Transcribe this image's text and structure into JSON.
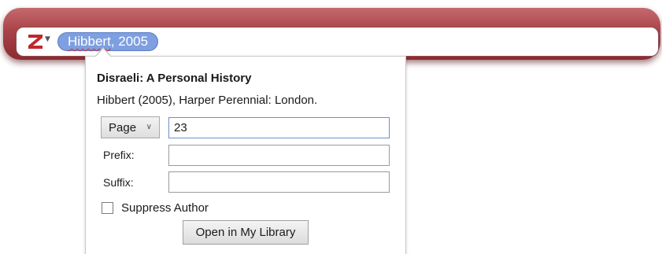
{
  "quick_format_bar": {
    "logo_icon": "zotero-z-logo-icon",
    "logo_color": "#c0272d",
    "menu_icon": "caret-down-icon",
    "citation": {
      "author": "Hibbert",
      "separator": ", ",
      "year": "2005"
    },
    "bar_color": "#a84248",
    "bubble_color": "#7e9fe0"
  },
  "popup": {
    "item_title": "Disraeli: A Personal History",
    "item_description": "Hibbert (2005), Harper Perennial: London.",
    "locator": {
      "type_selected": "Page",
      "value": "23"
    },
    "prefix": {
      "label": "Prefix:",
      "value": ""
    },
    "suffix": {
      "label": "Suffix:",
      "value": ""
    },
    "suppress_author": {
      "label": "Suppress Author",
      "checked": false
    },
    "open_button_label": "Open in My Library"
  }
}
